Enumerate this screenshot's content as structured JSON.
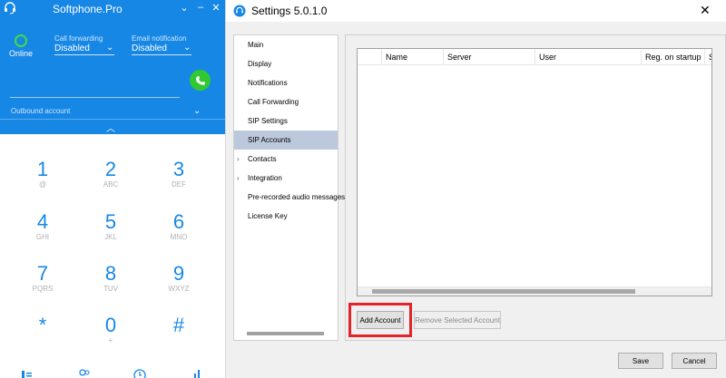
{
  "softphone": {
    "title": "Softphone.Pro",
    "window_buttons": [
      "⌄",
      "–",
      "✕"
    ],
    "status": "Online",
    "call_forwarding": {
      "label": "Call forwarding",
      "value": "Disabled"
    },
    "email_notification": {
      "label": "Email notification",
      "value": "Disabled"
    },
    "outbound_account": "Outbound account",
    "keypad": [
      {
        "digit": "1",
        "letters": "@"
      },
      {
        "digit": "2",
        "letters": "ABC"
      },
      {
        "digit": "3",
        "letters": "DEF"
      },
      {
        "digit": "4",
        "letters": "GHI"
      },
      {
        "digit": "5",
        "letters": "JKL"
      },
      {
        "digit": "6",
        "letters": "MNO"
      },
      {
        "digit": "7",
        "letters": "PQRS"
      },
      {
        "digit": "8",
        "letters": "TUV"
      },
      {
        "digit": "9",
        "letters": "WXYZ"
      },
      {
        "digit": "*",
        "letters": ""
      },
      {
        "digit": "0",
        "letters": "+"
      },
      {
        "digit": "#",
        "letters": ""
      }
    ],
    "colors": {
      "accent": "#1787e6",
      "call": "#32c832",
      "online": "#3fdc3f"
    }
  },
  "settings": {
    "title": "Settings 5.0.1.0",
    "close": "✕",
    "nav": [
      {
        "label": "Main",
        "expandable": false,
        "selected": false
      },
      {
        "label": "Display",
        "expandable": false,
        "selected": false
      },
      {
        "label": "Notifications",
        "expandable": false,
        "selected": false
      },
      {
        "label": "Call Forwarding",
        "expandable": false,
        "selected": false
      },
      {
        "label": "SIP Settings",
        "expandable": false,
        "selected": false
      },
      {
        "label": "SIP Accounts",
        "expandable": false,
        "selected": true
      },
      {
        "label": "Contacts",
        "expandable": true,
        "selected": false
      },
      {
        "label": "Integration",
        "expandable": true,
        "selected": false
      },
      {
        "label": "Pre-recorded audio messages",
        "expandable": false,
        "selected": false
      },
      {
        "label": "License Key",
        "expandable": false,
        "selected": false
      }
    ],
    "table_columns": [
      "Name",
      "Server",
      "User",
      "Reg. on startup",
      "S"
    ],
    "buttons": {
      "add_account": "Add Account",
      "remove_selected": "Remove Selected Account",
      "save": "Save",
      "cancel": "Cancel"
    },
    "colors": {
      "selection": "#bcc9dd",
      "highlight": "#e3222a"
    }
  }
}
